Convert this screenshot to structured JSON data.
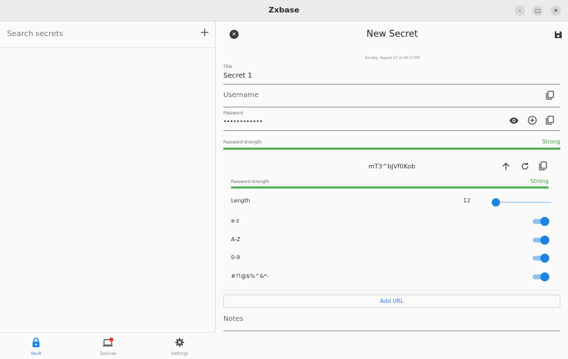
{
  "window": {
    "title": "Zxbase",
    "minimize_label": "–",
    "maximize_label": "□",
    "close_label": "✕"
  },
  "sidebar": {
    "search_placeholder": "Search secrets",
    "add_label": "+"
  },
  "nav": {
    "items": [
      {
        "label": "Vault",
        "icon": "lock-icon",
        "active": true
      },
      {
        "label": "Devices",
        "icon": "devices-icon",
        "badge": true
      },
      {
        "label": "Settings",
        "icon": "gear-icon"
      }
    ]
  },
  "secret": {
    "header_title": "New Secret",
    "close_label": "✕",
    "date": "Sunday, August 17 at 04:12 PM",
    "title_label": "Title",
    "title_value": "Secret 1",
    "username_placeholder": "Username",
    "password_label": "Password",
    "password_value": "••••••••••••",
    "strength_label": "Password strength",
    "strength_value": "Strong",
    "add_url_label": "Add URL",
    "notes_placeholder": "Notes"
  },
  "generator": {
    "password": "mT3^bJVf0Kob",
    "strength_label": "Password strength",
    "strength_value": "Strong",
    "length_label": "Length",
    "length_value": "12",
    "length_fraction": 0.05,
    "options": [
      {
        "label": "a-z",
        "on": true
      },
      {
        "label": "A-Z",
        "on": true
      },
      {
        "label": "0-9",
        "on": true
      },
      {
        "label": "#?!@$%^&*-",
        "on": true
      }
    ]
  },
  "colors": {
    "accent": "#1d83e2",
    "strength": "#4caf50"
  }
}
